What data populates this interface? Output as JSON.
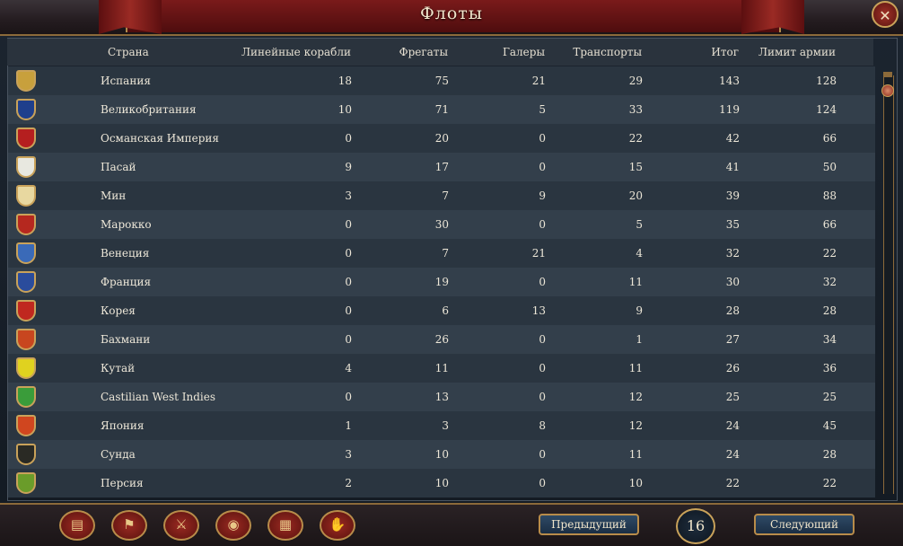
{
  "window": {
    "title": "Флоты",
    "close_symbol": "✕"
  },
  "columns": {
    "country": "Страна",
    "heavy": "Линейные корабли",
    "light": "Фрегаты",
    "galleys": "Галеры",
    "transports": "Транспорты",
    "total": "Итог",
    "limit": "Лимит армии"
  },
  "rows": [
    {
      "country": "Испания",
      "heavy": "18",
      "light": "75",
      "galleys": "21",
      "transports": "29",
      "total": "143",
      "limit": "128",
      "flag_color": "#c8a03c"
    },
    {
      "country": "Великобритания",
      "heavy": "10",
      "light": "71",
      "galleys": "5",
      "transports": "33",
      "total": "119",
      "limit": "124",
      "flag_color": "#1f3f8c"
    },
    {
      "country": "Османская Империя",
      "heavy": "0",
      "light": "20",
      "galleys": "0",
      "transports": "22",
      "total": "42",
      "limit": "66",
      "flag_color": "#b51f1f"
    },
    {
      "country": "Пасай",
      "heavy": "9",
      "light": "17",
      "galleys": "0",
      "transports": "15",
      "total": "41",
      "limit": "50",
      "flag_color": "#e8e8e0"
    },
    {
      "country": "Мин",
      "heavy": "3",
      "light": "7",
      "galleys": "9",
      "transports": "20",
      "total": "39",
      "limit": "88",
      "flag_color": "#e8d8a0"
    },
    {
      "country": "Марокко",
      "heavy": "0",
      "light": "30",
      "galleys": "0",
      "transports": "5",
      "total": "35",
      "limit": "66",
      "flag_color": "#b5281f"
    },
    {
      "country": "Венеция",
      "heavy": "0",
      "light": "7",
      "galleys": "21",
      "transports": "4",
      "total": "32",
      "limit": "22",
      "flag_color": "#3a6ab8"
    },
    {
      "country": "Франция",
      "heavy": "0",
      "light": "19",
      "galleys": "0",
      "transports": "11",
      "total": "30",
      "limit": "32",
      "flag_color": "#2a4c9c"
    },
    {
      "country": "Корея",
      "heavy": "0",
      "light": "6",
      "galleys": "13",
      "transports": "9",
      "total": "28",
      "limit": "28",
      "flag_color": "#c0281f"
    },
    {
      "country": "Бахмани",
      "heavy": "0",
      "light": "26",
      "galleys": "0",
      "transports": "1",
      "total": "27",
      "limit": "34",
      "flag_color": "#c8461f"
    },
    {
      "country": "Кутай",
      "heavy": "4",
      "light": "11",
      "galleys": "0",
      "transports": "11",
      "total": "26",
      "limit": "36",
      "flag_color": "#e0d21f"
    },
    {
      "country": "Castilian West Indies",
      "heavy": "0",
      "light": "13",
      "galleys": "0",
      "transports": "12",
      "total": "25",
      "limit": "25",
      "flag_color": "#3a9c3a"
    },
    {
      "country": "Япония",
      "heavy": "1",
      "light": "3",
      "galleys": "8",
      "transports": "12",
      "total": "24",
      "limit": "45",
      "flag_color": "#d0461f"
    },
    {
      "country": "Сунда",
      "heavy": "3",
      "light": "10",
      "galleys": "0",
      "transports": "11",
      "total": "24",
      "limit": "28",
      "flag_color": "#2a2a24"
    },
    {
      "country": "Персия",
      "heavy": "2",
      "light": "10",
      "galleys": "0",
      "transports": "10",
      "total": "22",
      "limit": "22",
      "flag_color": "#6a9c2a"
    }
  ],
  "bottom": {
    "tabs": [
      {
        "icon": "ledger-icon",
        "glyph": "▤"
      },
      {
        "icon": "flag-icon",
        "glyph": "⚑"
      },
      {
        "icon": "crossed-swords-icon",
        "glyph": "⚔"
      },
      {
        "icon": "coins-icon",
        "glyph": "◉"
      },
      {
        "icon": "building-icon",
        "glyph": "▦"
      },
      {
        "icon": "handshake-icon",
        "glyph": "✋"
      }
    ],
    "prev_label": "Предыдущий",
    "next_label": "Следующий",
    "page": "16"
  }
}
